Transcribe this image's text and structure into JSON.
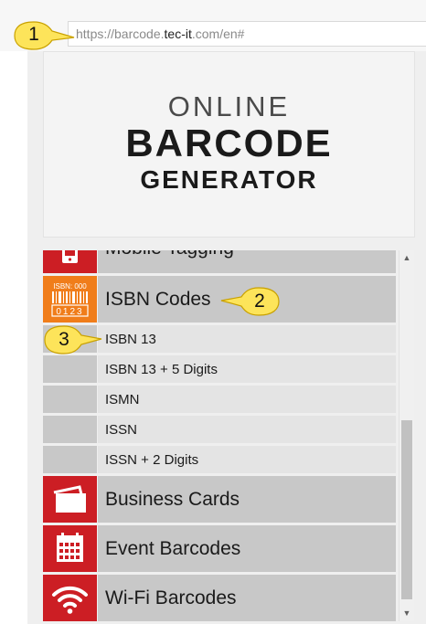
{
  "browser": {
    "url_prefix": "https://barcode.",
    "url_host": "tec-it",
    "url_suffix": ".com/en#"
  },
  "callouts": {
    "c1": "1",
    "c2": "2",
    "c3": "3"
  },
  "logo": {
    "line1": "ONLINE",
    "line2": "BARCODE",
    "line3": "GENERATOR"
  },
  "menu": {
    "mobile_tagging": "Mobile Tagging",
    "isbn_codes": "ISBN Codes",
    "isbn_icon_text": "ISBN: 000",
    "isbn_icon_digits": "0123",
    "sub_items": [
      "ISBN 13",
      "ISBN 13 + 5 Digits",
      "ISMN",
      "ISSN",
      "ISSN + 2 Digits"
    ],
    "business_cards": "Business Cards",
    "event_barcodes": "Event Barcodes",
    "wifi_barcodes": "Wi-Fi Barcodes"
  },
  "colors": {
    "category_red": "#cc1e24",
    "isbn_orange": "#f07d1a",
    "callout_yellow": "#fde45a"
  },
  "icons": [
    "mobile-icon",
    "isbn-barcode-icon",
    "business-card-icon",
    "calendar-icon",
    "wifi-icon"
  ]
}
